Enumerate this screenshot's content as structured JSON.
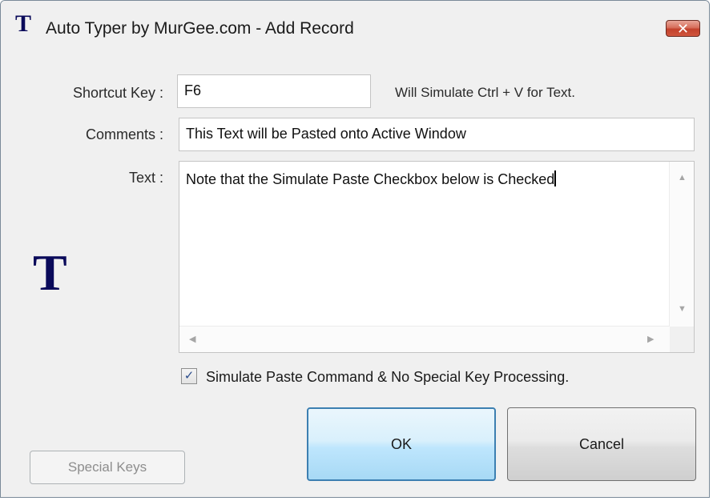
{
  "window": {
    "title": "Auto Typer by MurGee.com - Add Record",
    "title_icon_glyph": "T",
    "close_glyph": "✕"
  },
  "form": {
    "shortcut_label": "Shortcut Key :",
    "shortcut_value": "F6",
    "shortcut_hint": "Will Simulate Ctrl + V for Text.",
    "comments_label": "Comments :",
    "comments_value": "This Text will be Pasted onto Active Window",
    "text_label": "Text :",
    "text_value": "Note that the Simulate Paste Checkbox below is Checked",
    "big_icon_glyph": "T"
  },
  "checkbox": {
    "checked": true,
    "mark": "✓",
    "label": "Simulate Paste Command & No Special Key Processing."
  },
  "buttons": {
    "ok": "OK",
    "cancel": "Cancel",
    "special_keys": "Special Keys"
  },
  "icons": {
    "app": "app-t-icon",
    "close": "close-icon",
    "scroll_up": "scroll-up-arrow-icon",
    "scroll_down": "scroll-down-arrow-icon",
    "scroll_left": "scroll-left-arrow-icon",
    "scroll_right": "scroll-right-arrow-icon"
  },
  "colors": {
    "brand_icon": "#0a0a5a",
    "close_button": "#c7503a",
    "ok_border": "#3c7fb1"
  }
}
